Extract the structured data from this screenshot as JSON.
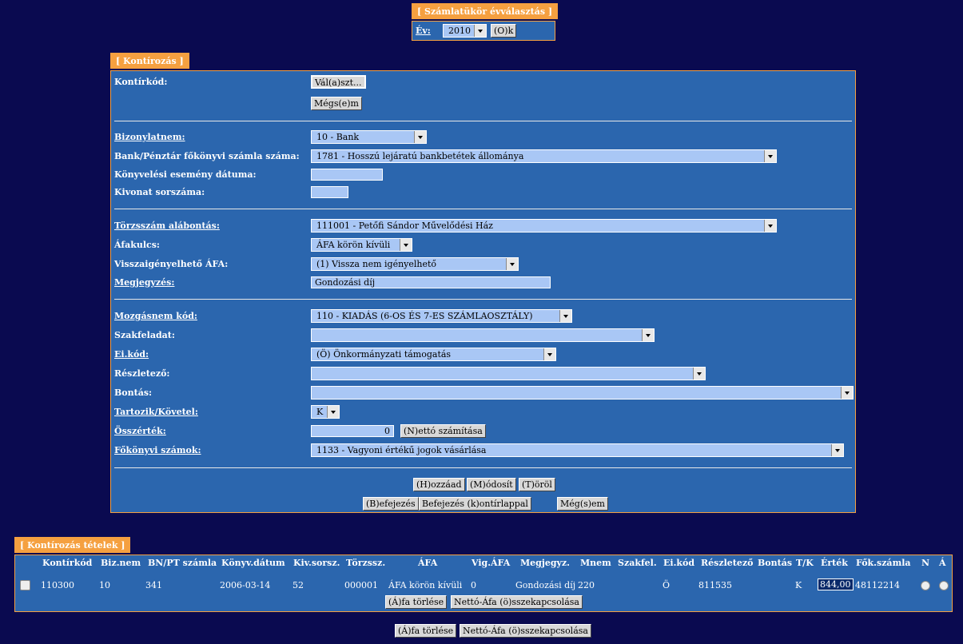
{
  "year_panel": {
    "title": "[ Számlatükör évválasztás ]",
    "year_label": "Év:",
    "year_value": "2010",
    "ok_button": "(O)k"
  },
  "kont": {
    "title": "[ Kontírozás ]",
    "kontirkod_label": "Kontírkód:",
    "valaszt_button": "Vál(a)szt...",
    "megsem_button": "Mégs(e)m",
    "bizonylatnem_label": "Bizonylatnem:",
    "bizonylatnem_value": "10 - Bank",
    "bank_label": "Bank/Pénztár főkönyvi számla száma:",
    "bank_value": "1781 - Hosszú lejáratú bankbetétek állománya",
    "datum_label": "Könyvelési esemény dátuma:",
    "datum_value": "",
    "kivonat_label": "Kivonat sorszáma:",
    "kivonat_value": "",
    "torzsszam_label": "Törzsszám alábontás:",
    "torzsszam_value": "111001 - Petőfi Sándor Művelődési Ház",
    "afakulcs_label": "Áfakulcs:",
    "afakulcs_value": "ÁFA körön kívüli",
    "visszaig_label": "Visszaigényelhető ÁFA:",
    "visszaig_value": "(1) Vissza nem igényelhető",
    "megjegyzes_label": "Megjegyzés:",
    "megjegyzes_value": "Gondozási díj",
    "mozgasnem_label": "Mozgásnem kód:",
    "mozgasnem_value": "110 - KIADÁS (6-OS ÉS 7-ES SZÁMLAOSZTÁLY)",
    "szakfeladat_label": "Szakfeladat:",
    "szakfeladat_value": "",
    "eikod_label": "Ei.kód:",
    "eikod_value": "(Ö) Önkormányzati támogatás",
    "reszletezo_label": "Részletező:",
    "reszletezo_value": "",
    "bontas_label": "Bontás:",
    "bontas_value": "",
    "tk_label": "Tartozik/Követel:",
    "tk_value": "K",
    "osszertek_label": "Összérték:",
    "osszertek_value": "0",
    "netto_button": "(N)ettó számítása",
    "fokonyvi_label": "Főkönyvi számok:",
    "fokonyvi_value": "1133 - Vagyoni értékű jogok vásárlása",
    "hozzaad_button": "(H)ozzáad",
    "modosit_button": "(M)ódosít",
    "torol_button": "(T)öröl",
    "befejezes_button": "(B)efejezés",
    "befejezes_k_button": "Befejezés (k)ontírlappal",
    "megsem2_button": "Még(s)em"
  },
  "tetelek": {
    "title": "[ Kontírozás tételek ]",
    "headers": [
      "Kontírkód",
      "Biz.nem",
      "BN/PT számla",
      "Könyv.dátum",
      "Kiv.sorsz.",
      "Törzssz.",
      "ÁFA",
      "Vig.ÁFA",
      "Megjegyz.",
      "Mnem",
      "Szakfel.",
      "Ei.kód",
      "Részletező",
      "Bontás",
      "T/K",
      "Érték",
      "Fők.számla",
      "N",
      "Á"
    ],
    "rows": [
      [
        "110300",
        "10",
        "341",
        "2006-03-14",
        "52",
        "000001",
        "ÁFA körön kívüli",
        "0",
        "Gondozási díj",
        "220",
        "",
        "Ö",
        "811535",
        "",
        "K",
        "844,00",
        "48112214"
      ]
    ],
    "afa_torles_button": "(Á)fa törlése",
    "netto_afa_button": "Nettó-Áfa (ö)sszekapcsolása"
  },
  "bottom": {
    "afa_torles_button": "(Á)fa törlése",
    "netto_afa_button": "Nettó-Áfa (ö)sszekapcsolása"
  }
}
